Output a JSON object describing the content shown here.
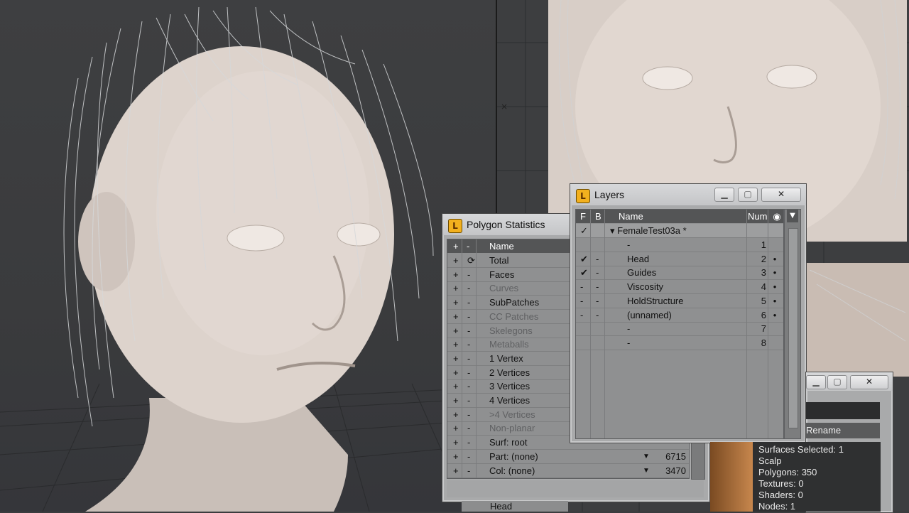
{
  "polygon_statistics": {
    "title": "Polygon Statistics",
    "header": {
      "plus": "+",
      "minus": "-",
      "name": "Name"
    },
    "rows": [
      {
        "name": "Total",
        "dim": false
      },
      {
        "name": "Faces",
        "dim": false
      },
      {
        "name": "Curves",
        "dim": true
      },
      {
        "name": "SubPatches",
        "dim": false
      },
      {
        "name": "CC Patches",
        "dim": true
      },
      {
        "name": "Skelegons",
        "dim": true
      },
      {
        "name": "Metaballs",
        "dim": true
      },
      {
        "name": "1 Vertex",
        "dim": false
      },
      {
        "name": "2 Vertices",
        "dim": false
      },
      {
        "name": "3 Vertices",
        "dim": false
      },
      {
        "name": "4 Vertices",
        "dim": false
      },
      {
        "name": ">4 Vertices",
        "dim": true
      },
      {
        "name": "Non-planar",
        "dim": true
      },
      {
        "name": "Surf: root",
        "dim": false
      },
      {
        "name": "Part: (none)",
        "dim": false,
        "value": "6715"
      },
      {
        "name": "Col: (none)",
        "dim": false,
        "value": "3470"
      }
    ]
  },
  "layers": {
    "title": "Layers",
    "header": {
      "f": "F",
      "b": "B",
      "name": "Name",
      "num": "Num"
    },
    "object": {
      "name": "FemaleTest03a *"
    },
    "rows": [
      {
        "f": "",
        "b": "",
        "name": "-",
        "num": "1",
        "dot": ""
      },
      {
        "f": "✔",
        "b": "-",
        "name": "Head",
        "num": "2",
        "dot": "•"
      },
      {
        "f": "✔",
        "b": "-",
        "name": "Guides",
        "num": "3",
        "dot": "•"
      },
      {
        "f": "-",
        "b": "-",
        "name": "Viscosity",
        "num": "4",
        "dot": "•"
      },
      {
        "f": "-",
        "b": "-",
        "name": "HoldStructure",
        "num": "5",
        "dot": "•"
      },
      {
        "f": "-",
        "b": "-",
        "name": "(unnamed)",
        "num": "6",
        "dot": "•"
      },
      {
        "f": "",
        "b": "",
        "name": "-",
        "num": "7",
        "dot": ""
      },
      {
        "f": "",
        "b": "",
        "name": "-",
        "num": "8",
        "dot": ""
      }
    ]
  },
  "surface_editor": {
    "rename_label": "Rename",
    "info": [
      "Surfaces Selected: 1",
      "Scalp",
      "Polygons: 350",
      "Textures: 0",
      "Shaders: 0",
      "Nodes: 1"
    ],
    "list_item": "Head"
  },
  "window_buttons": {
    "minimize": "▁",
    "maximize": "▢",
    "close": "✕"
  },
  "icons": {
    "app": "lightwave-icon",
    "refresh": "refresh-icon"
  }
}
